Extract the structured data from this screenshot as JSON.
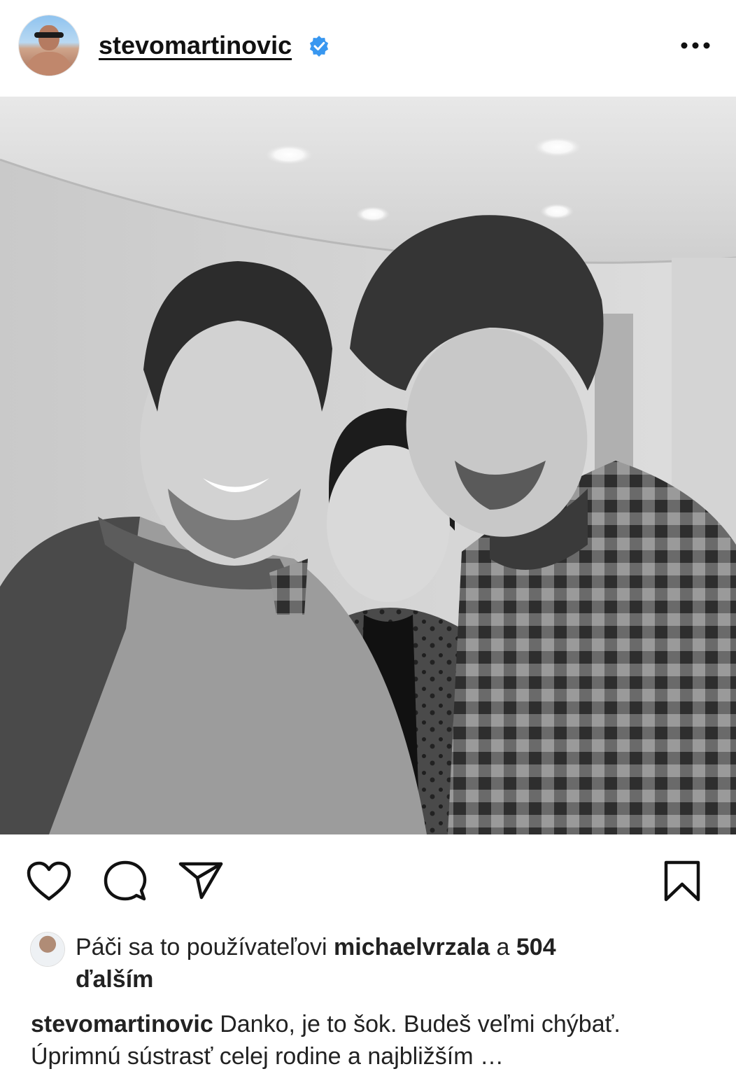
{
  "post": {
    "username": "stevomartinovic",
    "verified": true
  },
  "icons": {
    "avatar": "user-avatar",
    "verified": "verified-badge-icon",
    "more": "more-options-icon",
    "like": "heart-icon",
    "comment": "comment-bubble-icon",
    "share": "send-paper-plane-icon",
    "save": "bookmark-icon"
  },
  "colors": {
    "verified_blue": "#3897f0",
    "text": "#111111"
  },
  "likes": {
    "prefix": "Páči sa to používateľovi",
    "liker": "michaelvrzala",
    "connector": "a",
    "count": "504",
    "suffix": "ďalším"
  },
  "caption": {
    "author": "stevomartinovic",
    "text_line1": "Danko, je to šok. Budeš veľmi chýbať.",
    "text_line2": "Úprimnú sústrasť celej rodine a najbližším",
    "more": "…"
  }
}
